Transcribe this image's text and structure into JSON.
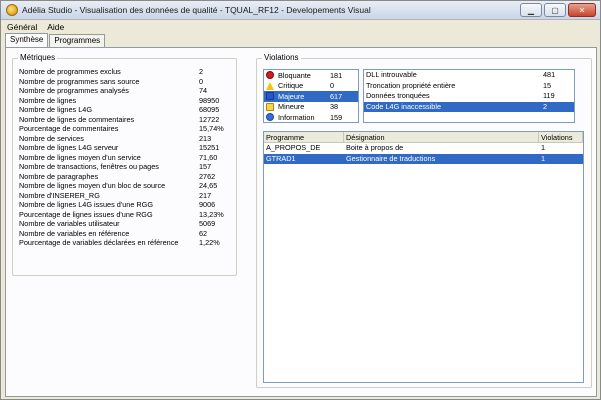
{
  "window": {
    "title": "Adélia Studio - Visualisation des données de qualité - TQUAL_RF12 - Developements Visual"
  },
  "menu": {
    "items": [
      "Général",
      "Aide"
    ]
  },
  "tabs": [
    "Synthèse",
    "Programmes"
  ],
  "metrics": {
    "title": "Métriques",
    "rows": [
      {
        "label": "Nombre de programmes exclus",
        "value": "2"
      },
      {
        "label": "Nombre de programmes sans source",
        "value": "0"
      },
      {
        "label": "Nombre de programmes analysés",
        "value": "74"
      },
      {
        "label": "Nombre de lignes",
        "value": "98950"
      },
      {
        "label": "Nombre de lignes L4G",
        "value": "68095"
      },
      {
        "label": "Nombre de lignes de commentaires",
        "value": "12722"
      },
      {
        "label": "Pourcentage de commentaires",
        "value": "15,74%"
      },
      {
        "label": "Nombre de services",
        "value": "213"
      },
      {
        "label": "Nombre de lignes L4G serveur",
        "value": "15251"
      },
      {
        "label": "Nombre de lignes moyen d'un service",
        "value": "71,60"
      },
      {
        "label": "Nombre de transactions, fenêtres ou pages",
        "value": "157"
      },
      {
        "label": "Nombre de paragraphes",
        "value": "2762"
      },
      {
        "label": "Nombre de lignes moyen d'un bloc de source",
        "value": "24,65"
      },
      {
        "label": "Nombre d'INSERER_RG",
        "value": "217"
      },
      {
        "label": "Nombre de lignes L4G issues d'une RGG",
        "value": "9006"
      },
      {
        "label": "Pourcentage de lignes issues d'une RGG",
        "value": "13,23%"
      },
      {
        "label": "Nombre de variables utilisateur",
        "value": "5069"
      },
      {
        "label": "Nombre de variables en référence",
        "value": "62"
      },
      {
        "label": "Pourcentage de variables déclarées en référence",
        "value": "1,22%"
      }
    ]
  },
  "violations": {
    "title": "Violations",
    "severities": [
      {
        "icon": "stop-icon",
        "label": "Bloquante",
        "value": "181"
      },
      {
        "icon": "warning-icon",
        "label": "Critique",
        "value": "0"
      },
      {
        "icon": "major-icon",
        "label": "Majeure",
        "value": "617"
      },
      {
        "icon": "minor-icon",
        "label": "Mineure",
        "value": "38"
      },
      {
        "icon": "info-icon",
        "label": "Information",
        "value": "159"
      }
    ],
    "rules": [
      {
        "label": "DLL introuvable",
        "value": "481"
      },
      {
        "label": "Troncation propriété entière",
        "value": "15"
      },
      {
        "label": "Données tronquées",
        "value": "119"
      },
      {
        "label": "Code L4G inaccessible",
        "value": "2"
      }
    ],
    "table": {
      "headers": [
        "Programme",
        "Désignation",
        "Violations"
      ],
      "rows": [
        {
          "programme": "A_PROPOS_DE",
          "designation": "Boite à propos de",
          "violations": "1"
        },
        {
          "programme": "GTRAD1",
          "designation": "Gestionnaire de traductions",
          "violations": "1"
        }
      ]
    }
  },
  "colors": {
    "selection": "#316ac5",
    "window_bg": "#ece9d8"
  }
}
